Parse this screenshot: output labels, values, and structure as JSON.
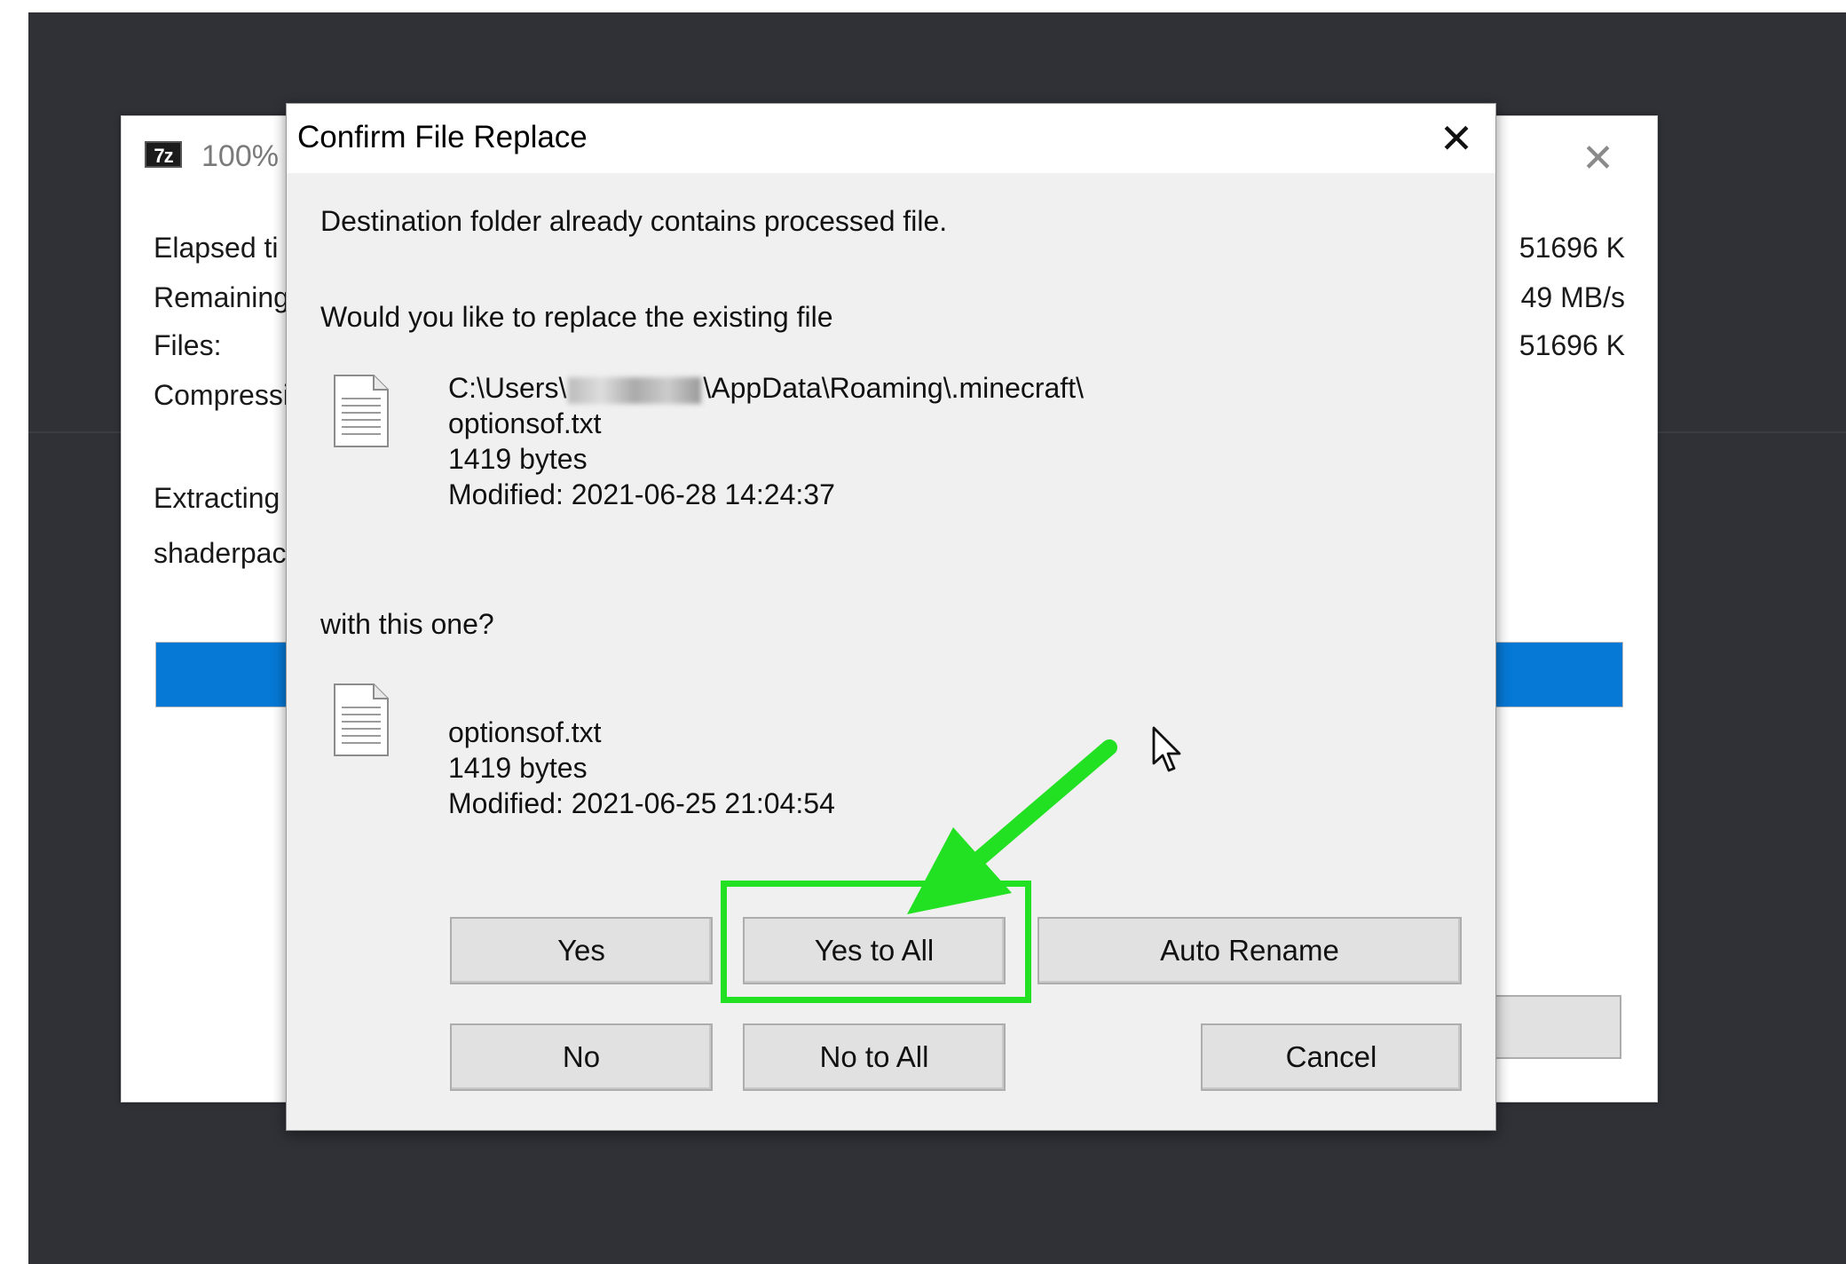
{
  "background_window": {
    "title_prefix": "100%",
    "labels": [
      "Elapsed ti",
      "Remaining",
      "Files:",
      "Compressi"
    ],
    "values": [
      "51696 K",
      "49 MB/s",
      "51696 K"
    ],
    "extracting_label": "Extracting",
    "current_file_fragment": "shaderpac",
    "progress": 1.0,
    "progress_color": "#0679d6"
  },
  "dialog": {
    "title": "Confirm File Replace",
    "message": "Destination folder already contains processed file.",
    "question": "Would you like to replace the existing file",
    "existing_file": {
      "path_prefix": "C:\\Users\\",
      "path_suffix": "\\AppData\\Roaming\\.minecraft\\",
      "name": "optionsof.txt",
      "size": "1419 bytes",
      "modified": "Modified: 2021-06-28 14:24:37"
    },
    "with_label": "with this one?",
    "new_file": {
      "name": "optionsof.txt",
      "size": "1419 bytes",
      "modified": "Modified: 2021-06-25 21:04:54"
    },
    "buttons": {
      "yes": "Yes",
      "yes_to_all": "Yes to All",
      "auto_rename": "Auto Rename",
      "no": "No",
      "no_to_all": "No to All",
      "cancel": "Cancel"
    }
  },
  "annotation": {
    "highlight_color": "#22e022",
    "highlight_icon": "green-arrow-icon"
  }
}
